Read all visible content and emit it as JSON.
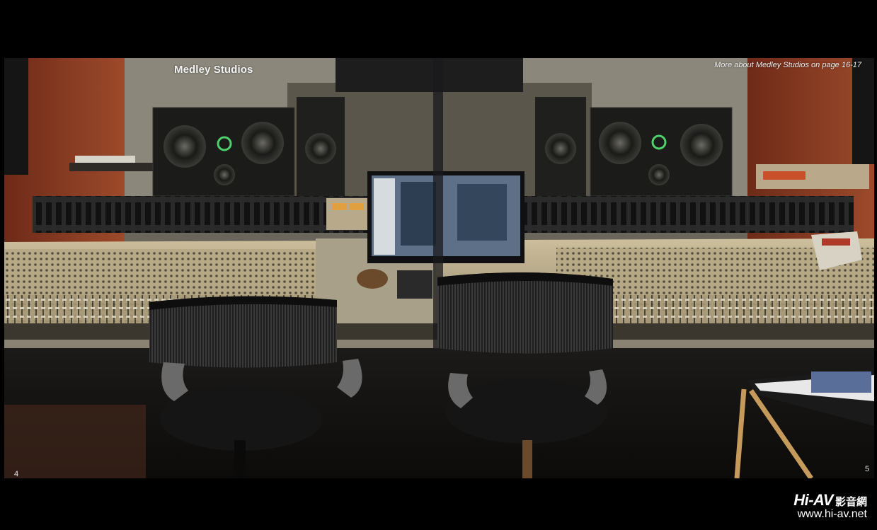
{
  "photo": {
    "caption_left": "Medley Studios",
    "caption_right": "More about Medley Studios on page 16-17",
    "page_left": "4",
    "page_right": "5"
  },
  "watermark": {
    "logo_latin": "Hi-AV",
    "logo_cjk": "影音網",
    "url": "www.hi-av.net"
  },
  "colors": {
    "background": "#000000",
    "wall_wood": "#8a3a22",
    "console_metal": "#b9aa88"
  }
}
